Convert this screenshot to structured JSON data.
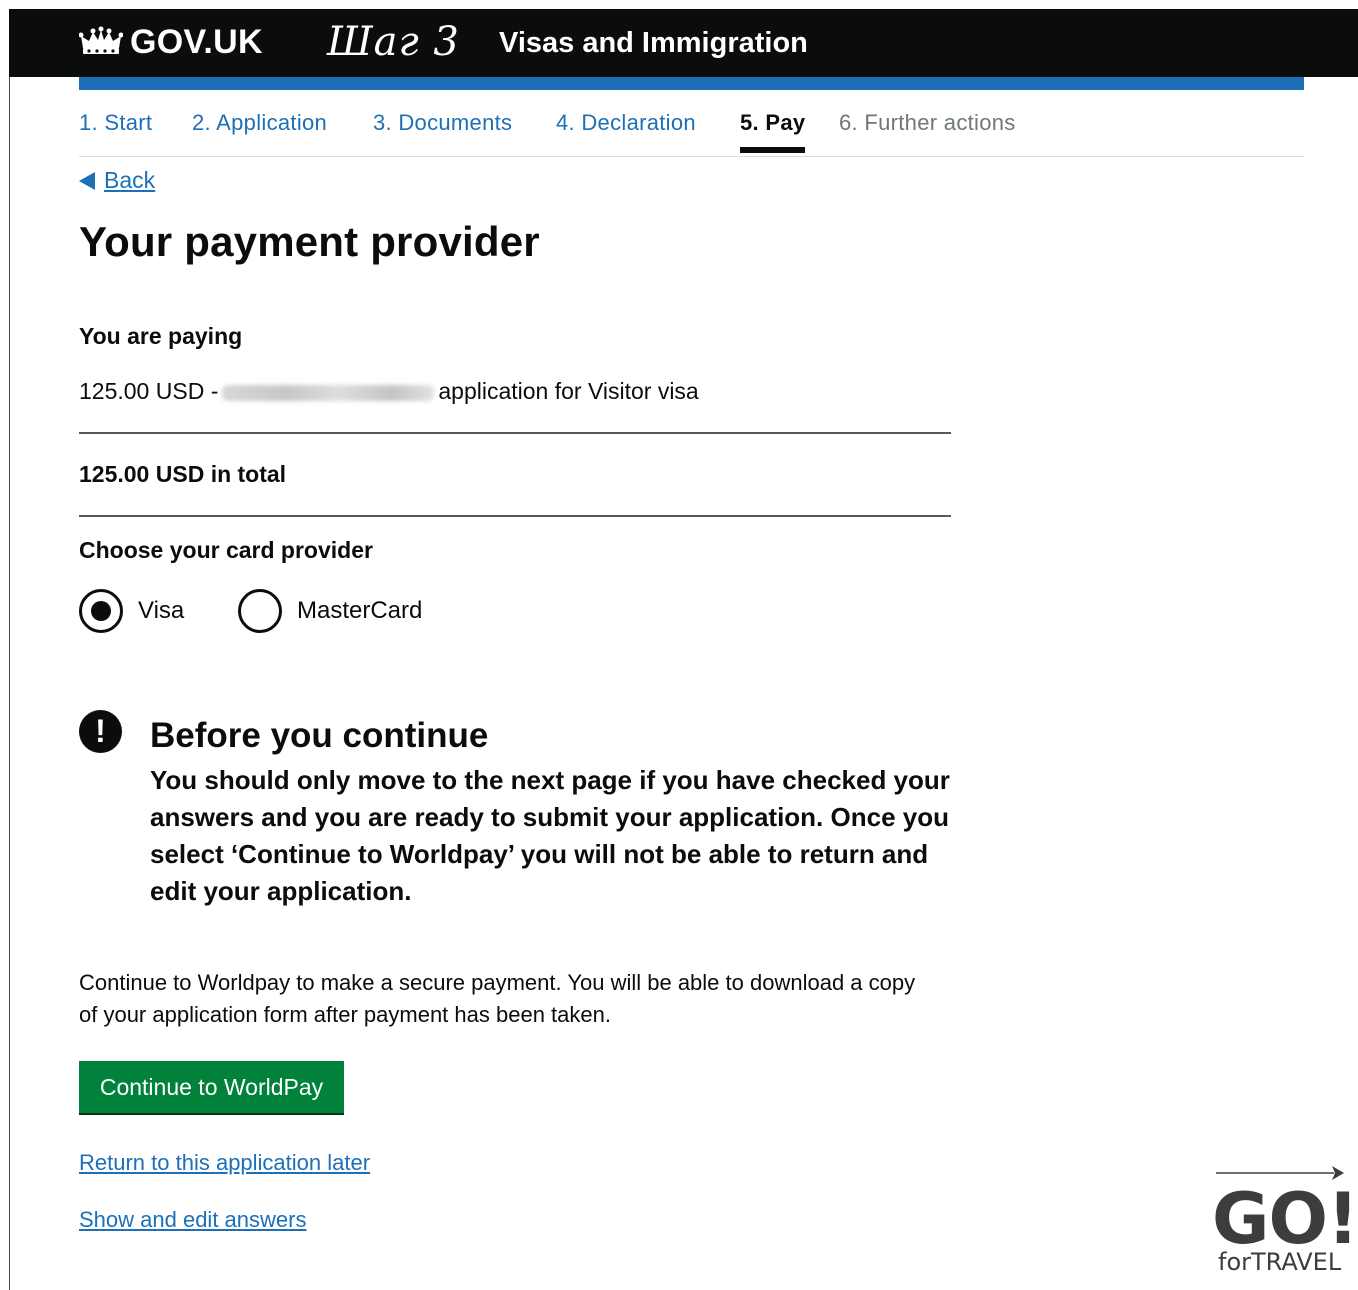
{
  "header": {
    "brand": "GOV.UK",
    "step_tag": "Шаг 3",
    "service": "Visas and Immigration"
  },
  "steps": [
    {
      "label": "1. Start",
      "state": "done"
    },
    {
      "label": "2. Application",
      "state": "done"
    },
    {
      "label": "3. Documents",
      "state": "done"
    },
    {
      "label": "4. Declaration",
      "state": "done"
    },
    {
      "label": "5. Pay",
      "state": "current"
    },
    {
      "label": "6. Further actions",
      "state": "future"
    }
  ],
  "back_label": "Back",
  "page_title": "Your payment provider",
  "payment": {
    "heading": "You are paying",
    "amount": "125.00 USD -",
    "description": "application for Visitor visa",
    "total": "125.00 USD in total"
  },
  "card_provider": {
    "heading": "Choose your card provider",
    "options": [
      {
        "label": "Visa",
        "selected": true
      },
      {
        "label": "MasterCard",
        "selected": false
      }
    ]
  },
  "warning": {
    "icon": "!",
    "title": "Before you continue",
    "body": "You should only move to the next page if you have checked your answers and you are ready to submit your application. Once you select ‘Continue to Worldpay’ you will not be able to return and edit your application."
  },
  "info_text": "Continue to Worldpay to make a secure payment. You will be able to download a copy of your application form after payment has been taken.",
  "continue_button": "Continue to WorldPay",
  "links": {
    "return_later": "Return to this application later",
    "show_edit": "Show and edit answers"
  },
  "watermark": {
    "go": "GO!",
    "sub": "forTRAVEL"
  },
  "colors": {
    "header_bg": "#0b0c0c",
    "accent_blue": "#1d70b8",
    "button_green": "#00823b"
  }
}
